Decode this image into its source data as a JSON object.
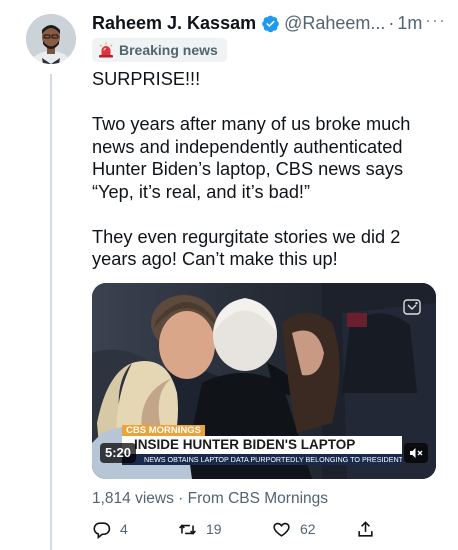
{
  "tweet": {
    "author_name": "Raheem J. Kassam",
    "handle": "@Raheem...",
    "separator": "·",
    "time": "1m",
    "more_label": "···",
    "badge_label": "Breaking news",
    "paragraphs": [
      "SURPRISE!!!",
      "Two years after many of us broke much news and independently authenticated Hunter Biden’s laptop, CBS news says “Yep, it’s real, and it’s bad!”",
      "They even regurgitate stories we did 2 years ago! Can’t make this up!"
    ]
  },
  "media": {
    "duration": "5:20",
    "brand": "CBS MORNINGS",
    "headline": "INSIDE HUNTER BIDEN'S LAPTOP",
    "subheadline": "NEWS OBTAINS LAPTOP DATA PURPORTEDLY BELONGING TO PRESIDENT'S SON"
  },
  "meta": {
    "text": "1,814 views · From CBS Mornings"
  },
  "actions": {
    "replies": "4",
    "retweets": "19",
    "likes": "62"
  },
  "colors": {
    "verified": "#1d9bf0",
    "secondary_text": "#536471",
    "badge_bg": "#eff3f4",
    "thread_line": "#cfd9de"
  },
  "icons": [
    "verified-badge-icon",
    "siren-icon",
    "more-icon",
    "gif-sparkle-icon",
    "mute-icon",
    "reply-icon",
    "retweet-icon",
    "like-icon",
    "share-icon"
  ]
}
